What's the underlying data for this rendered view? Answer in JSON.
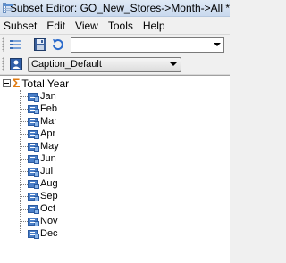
{
  "window": {
    "title": "Subset Editor:  GO_New_Stores->Month->All  *"
  },
  "menu": {
    "items": [
      "Subset",
      "Edit",
      "View",
      "Tools",
      "Help"
    ]
  },
  "toolbar": {
    "subset_combo_value": "",
    "alias_combo_value": "Caption_Default"
  },
  "tree": {
    "root_label": "Total Year",
    "children": [
      "Jan",
      "Feb",
      "Mar",
      "Apr",
      "May",
      "Jun",
      "Jul",
      "Aug",
      "Sep",
      "Oct",
      "Nov",
      "Dec"
    ]
  }
}
